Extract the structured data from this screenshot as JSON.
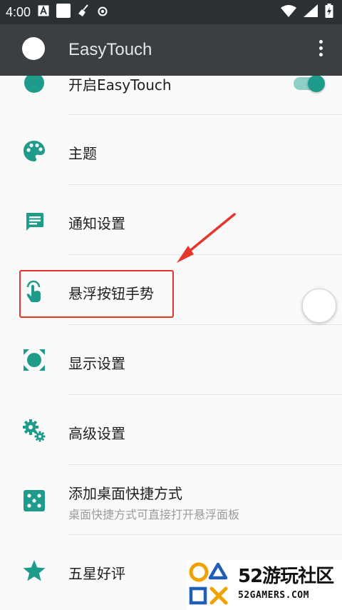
{
  "status_bar": {
    "time": "4:00",
    "icons": [
      "a-notification-icon",
      "square-notification-icon",
      "broom-icon",
      "record-icon",
      "wifi-icon",
      "battery-icon"
    ]
  },
  "app_bar": {
    "title": "EasyTouch",
    "menu_icon": "more-vert-icon"
  },
  "settings": [
    {
      "label": "开启EasyTouch",
      "icon": "toggle-dot-icon",
      "toggle_on": true
    },
    {
      "label": "主题",
      "icon": "palette-icon"
    },
    {
      "label": "通知设置",
      "icon": "message-icon"
    },
    {
      "label": "悬浮按钮手势",
      "icon": "touch-gesture-icon"
    },
    {
      "label": "显示设置",
      "icon": "display-icon"
    },
    {
      "label": "高级设置",
      "icon": "gears-icon"
    },
    {
      "label": "添加桌面快捷方式",
      "sub": "桌面快捷方式可直接打开悬浮面板",
      "icon": "dice-icon"
    },
    {
      "label": "五星好评",
      "icon": "star-icon"
    }
  ],
  "watermark": {
    "name": "52游玩社区",
    "site": "52GAMERS.COM"
  },
  "colors": {
    "accent": "#1e9b8a",
    "app_bar": "#3a3f42",
    "status_bar": "#2b3033",
    "highlight": "#e8352b"
  }
}
